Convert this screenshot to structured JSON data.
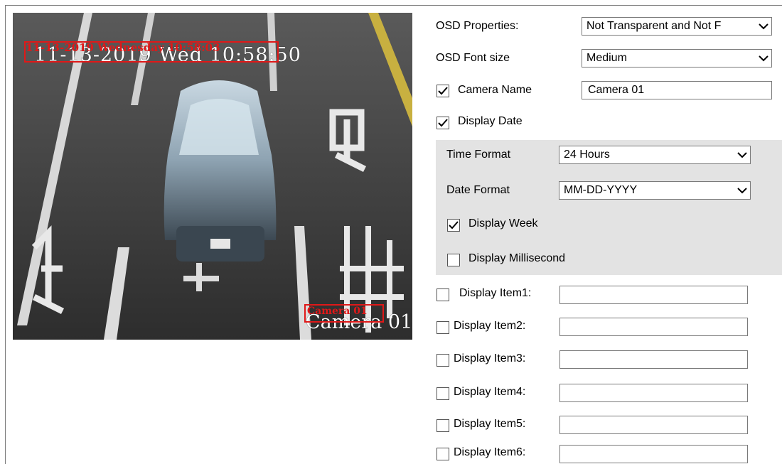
{
  "preview": {
    "osd_date_text": "11-13-2019 Wed 10:58:50",
    "osd_date_preview_text": "11-13-2019 Wednesday 10:58:03",
    "osd_camera_text": "Camera 01",
    "osd_camera_preview_text": "Camera 01"
  },
  "osd_properties": {
    "label": "OSD Properties:",
    "value": "Not Transparent and Not F"
  },
  "osd_font_size": {
    "label": "OSD Font size",
    "value": "Medium"
  },
  "camera_name": {
    "label": "Camera Name",
    "checked": true,
    "value": "Camera 01"
  },
  "display_date": {
    "label": "Display Date",
    "checked": true
  },
  "time_format": {
    "label": "Time Format",
    "value": "24 Hours"
  },
  "date_format": {
    "label": "Date Format",
    "value": "MM-DD-YYYY"
  },
  "display_week": {
    "label": "Display Week",
    "checked": true
  },
  "display_millisecond": {
    "label": "Display Millisecond",
    "checked": false
  },
  "display_items": [
    {
      "label": "Display Item1:",
      "checked": false,
      "value": ""
    },
    {
      "label": "Display Item2:",
      "checked": false,
      "value": ""
    },
    {
      "label": "Display Item3:",
      "checked": false,
      "value": ""
    },
    {
      "label": "Display Item4:",
      "checked": false,
      "value": ""
    },
    {
      "label": "Display Item5:",
      "checked": false,
      "value": ""
    },
    {
      "label": "Display Item6:",
      "checked": false,
      "value": ""
    }
  ],
  "icons": {
    "dropdown": "chevron-down-icon",
    "checked": "checkmark-icon"
  }
}
